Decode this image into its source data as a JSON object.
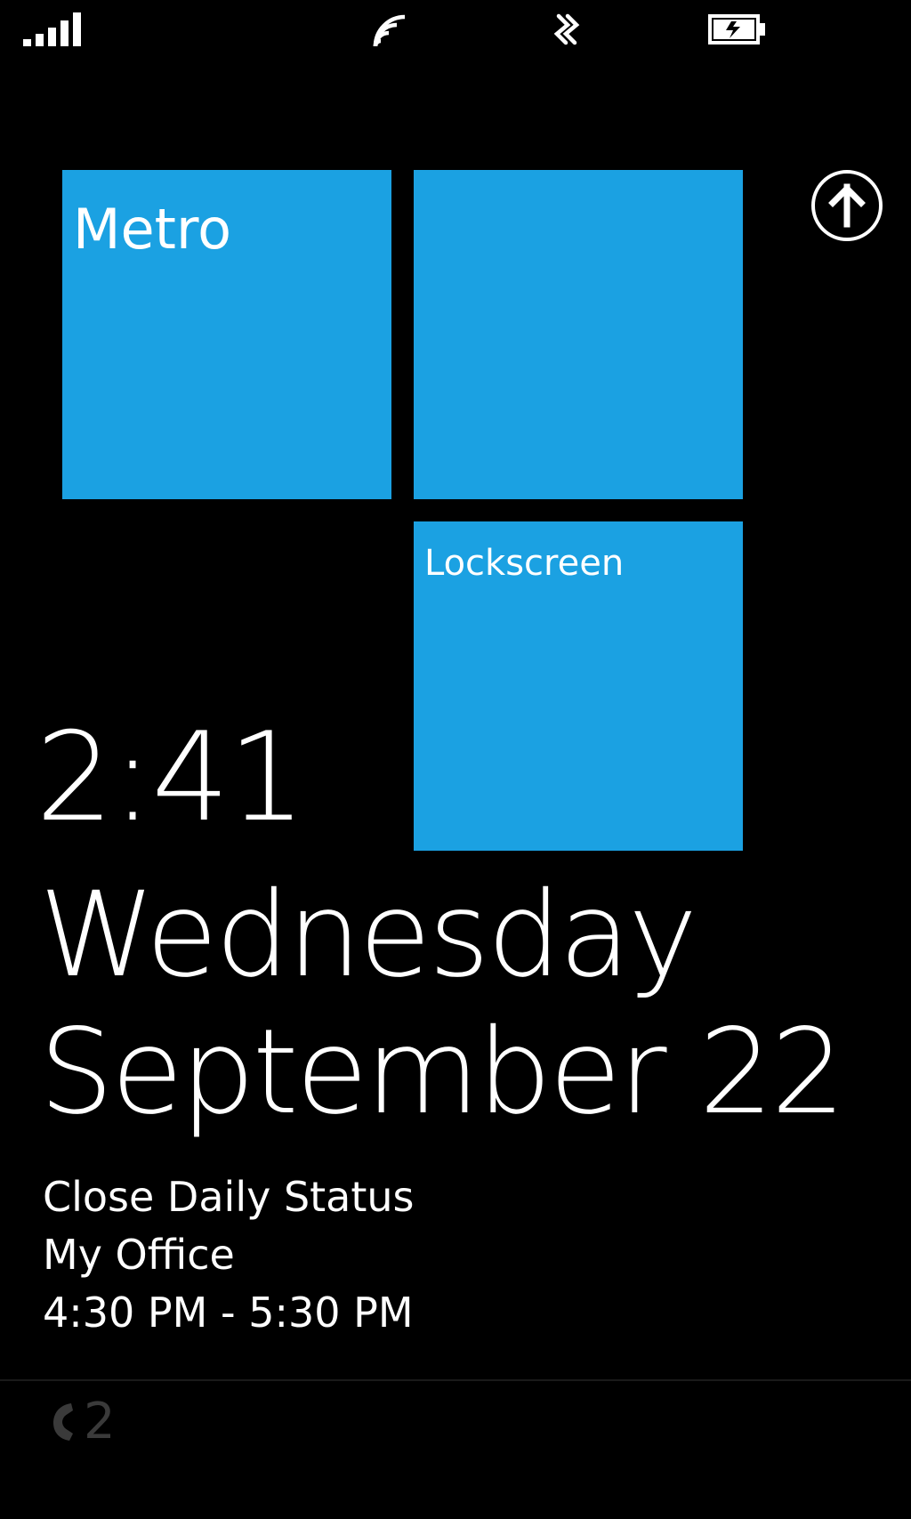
{
  "status_bar": {
    "icons": [
      "signal-strength-icon",
      "wifi-icon",
      "data-connection-icon",
      "battery-charging-icon"
    ]
  },
  "tiles": [
    {
      "label": "Metro",
      "color": "#1ba1e2"
    },
    {
      "label": "",
      "color": "#1ba1e2"
    },
    {
      "label": "Lockscreen",
      "color": "#1ba1e2"
    }
  ],
  "unlock": {
    "icon": "arrow-up-icon"
  },
  "clock": {
    "time": "2:41",
    "day": "Wednesday",
    "date": "September 22"
  },
  "calendar": {
    "title": "Close Daily Status",
    "location": "My Office",
    "time_range": "4:30 PM - 5:30 PM"
  },
  "notifications": {
    "icon": "missed-call-icon",
    "count": "2"
  }
}
